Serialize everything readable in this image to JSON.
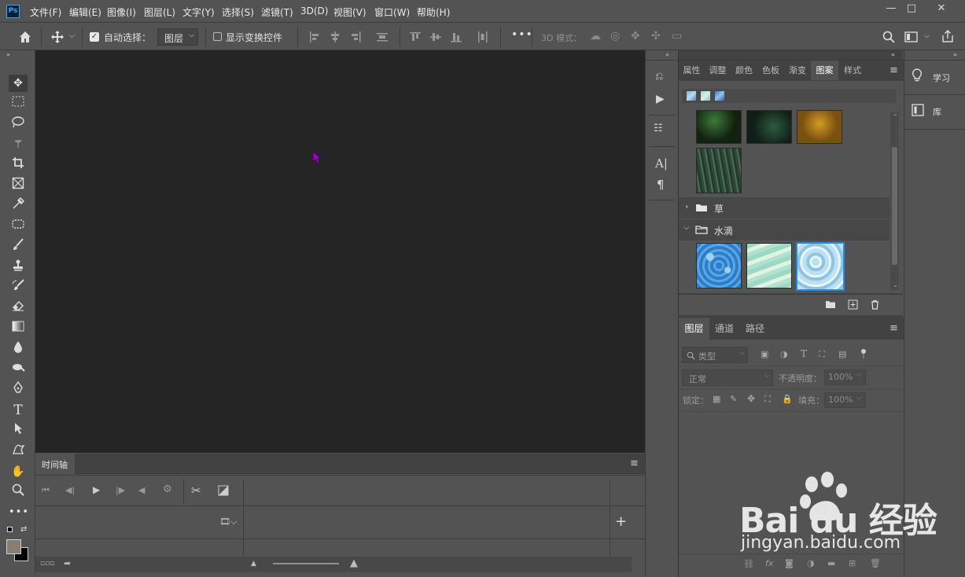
{
  "app": {
    "logo": "Ps"
  },
  "menu": [
    "文件(F)",
    "编辑(E)",
    "图像(I)",
    "图层(L)",
    "文字(Y)",
    "选择(S)",
    "滤镜(T)",
    "3D(D)",
    "视图(V)",
    "窗口(W)",
    "帮助(H)"
  ],
  "window_controls": {
    "minimize": "—",
    "maximize": "□",
    "close": "✕"
  },
  "options": {
    "auto_select_label": "自动选择：",
    "auto_select_checked": true,
    "target_select": "图层",
    "show_transform_label": "显示变换控件",
    "more": "•••",
    "mode_3d_label": "3D 模式："
  },
  "timeline": {
    "title": "时间轴"
  },
  "pattern_panel": {
    "tabs": [
      "属性",
      "调整",
      "颜色",
      "色板",
      "渐变",
      "图案",
      "样式"
    ],
    "active_tab": "图案",
    "groups": [
      {
        "name": "草",
        "expanded": false
      },
      {
        "name": "水滴",
        "expanded": true
      }
    ]
  },
  "side_panel": {
    "learn": "学习",
    "library": "库"
  },
  "layers_panel": {
    "tabs": [
      "图层",
      "通道",
      "路径"
    ],
    "active_tab": "图层",
    "filter_placeholder": "类型",
    "blend_mode": "正常",
    "opacity_label": "不透明度：",
    "opacity_value": "100%",
    "lock_label": "锁定：",
    "fill_label": "填充：",
    "fill_value": "100%"
  },
  "watermark": {
    "text": "Bai du 经验",
    "url": "jingyan.baidu.com"
  }
}
